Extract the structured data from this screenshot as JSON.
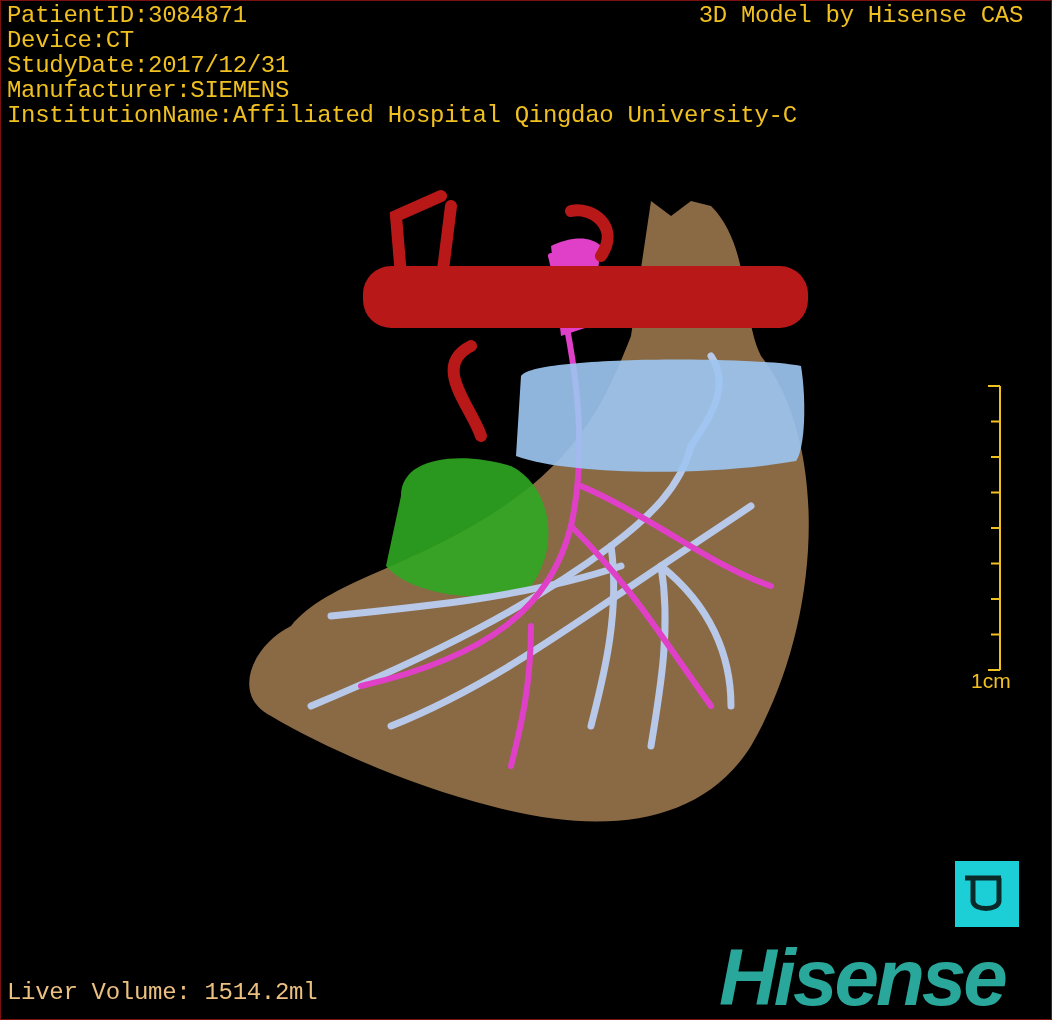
{
  "patient_info": [
    "PatientID:3084871",
    "Device:CT",
    "StudyDate:2017/12/31",
    "Manufacturer:SIEMENS",
    "InstitutionName:Affiliated Hospital Qingdao University-C"
  ],
  "title": "3D Model by Hisense CAS",
  "scale_bar": {
    "label": "1cm"
  },
  "liver_volume": "Liver Volume: 1514.2ml",
  "brand": "Hisense"
}
